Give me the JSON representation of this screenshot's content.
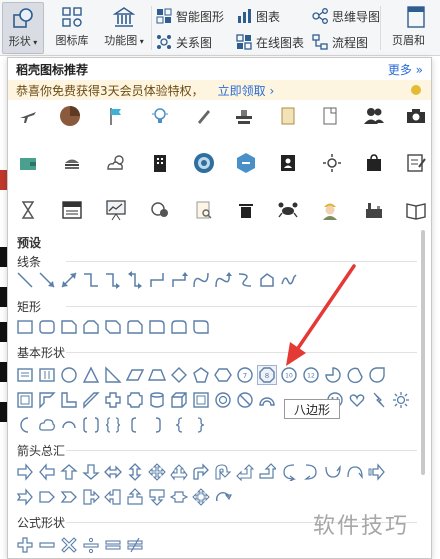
{
  "ribbon": {
    "shape_label": "形状",
    "icon_lib_label": "图标库",
    "func_chart_label": "功能图",
    "smart_shape_label": "智能图形",
    "chart_label": "图表",
    "mind_map_label": "思维导图",
    "relation_label": "关系图",
    "online_chart_label": "在线图表",
    "flowchart_label": "流程图",
    "header_footer_label": "页眉和"
  },
  "panel": {
    "title": "稻壳图标推荐",
    "more_label": "更多 »",
    "promo_text": "恭喜你免费获得3天会员体验特权，",
    "promo_claim": "立即领取 ›"
  },
  "sections": {
    "presets": "预设",
    "lines": "线条",
    "rectangles": "矩形",
    "basic": "基本形状",
    "arrows": "箭头总汇",
    "formula": "公式形状"
  },
  "tooltip": "八边形",
  "watermark": "软件技巧",
  "colors": {
    "accent": "#2a6bd8",
    "promo_bg": "#fdf5df",
    "shape_stroke": "#5b7fa8",
    "arrow": "#e53935"
  }
}
